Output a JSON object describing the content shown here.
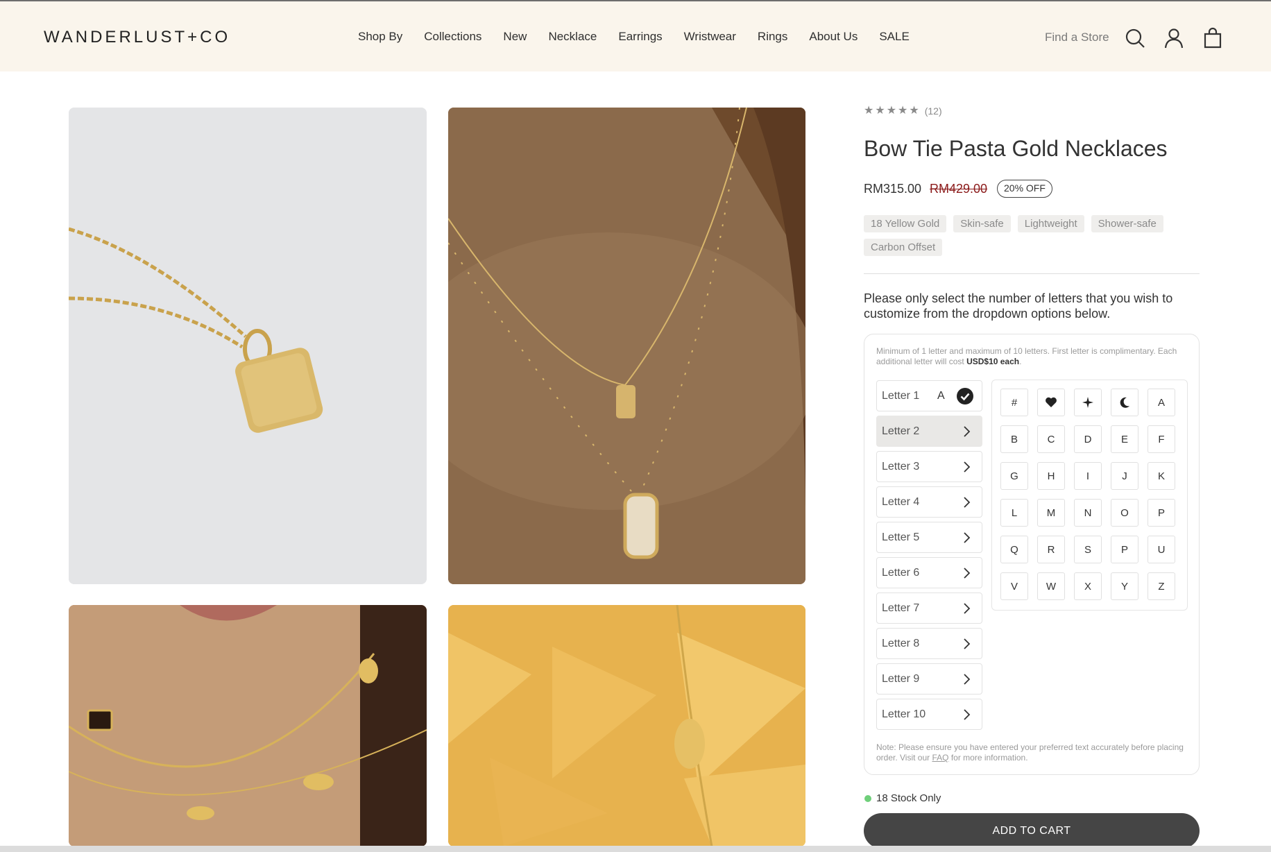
{
  "brand": {
    "logo": "WANDERLUST+CO"
  },
  "nav": {
    "items": [
      "Shop By",
      "Collections",
      "New",
      "Necklace",
      "Earrings",
      "Wristwear",
      "Rings",
      "About Us",
      "SALE"
    ],
    "find_store": "Find a Store"
  },
  "product": {
    "rating_count": "(12)",
    "title": "Bow Tie Pasta Gold Necklaces",
    "price": "RM315.00",
    "old_price": "RM429.00",
    "discount": "20% OFF",
    "tags": [
      "18 Yellow Gold",
      "Skin-safe",
      "Lightweight",
      "Shower-safe",
      "Carbon Offset"
    ],
    "instructions": "Please only select the number of letters that you wish to customize from the dropdown options below.",
    "stock": "18 Stock Only",
    "add_to_cart": "ADD TO CART"
  },
  "customizer": {
    "note_prefix": "Minimum of 1 letter and maximum of 10 letters. First letter is complimentary. Each additional letter will cost ",
    "note_price": "USD$10 each",
    "note_suffix": ".",
    "letters": [
      {
        "label": "Letter 1",
        "value": "A"
      },
      {
        "label": "Letter 2",
        "value": ""
      },
      {
        "label": "Letter 3",
        "value": ""
      },
      {
        "label": "Letter 4",
        "value": ""
      },
      {
        "label": "Letter 5",
        "value": ""
      },
      {
        "label": "Letter 6",
        "value": ""
      },
      {
        "label": "Letter 7",
        "value": ""
      },
      {
        "label": "Letter 8",
        "value": ""
      },
      {
        "label": "Letter 9",
        "value": ""
      },
      {
        "label": "Letter 10",
        "value": ""
      }
    ],
    "characters": [
      "#",
      "heart-icon",
      "sparkle-icon",
      "moon-icon",
      "A",
      "B",
      "C",
      "D",
      "E",
      "F",
      "G",
      "H",
      "I",
      "J",
      "K",
      "L",
      "M",
      "N",
      "O",
      "P",
      "Q",
      "R",
      "S",
      "P",
      "U",
      "V",
      "W",
      "X",
      "Y",
      "Z"
    ],
    "bottom_note_prefix": "Note: Please ensure you have entered your preferred text accurately before placing order. Visit our ",
    "bottom_note_link": "FAQ",
    "bottom_note_suffix": " for more information."
  },
  "colors": {
    "header_bg": "#faf5ec",
    "stock_dot": "#6fcf7a",
    "old_price": "#8b1a1a",
    "button": "#454545"
  }
}
